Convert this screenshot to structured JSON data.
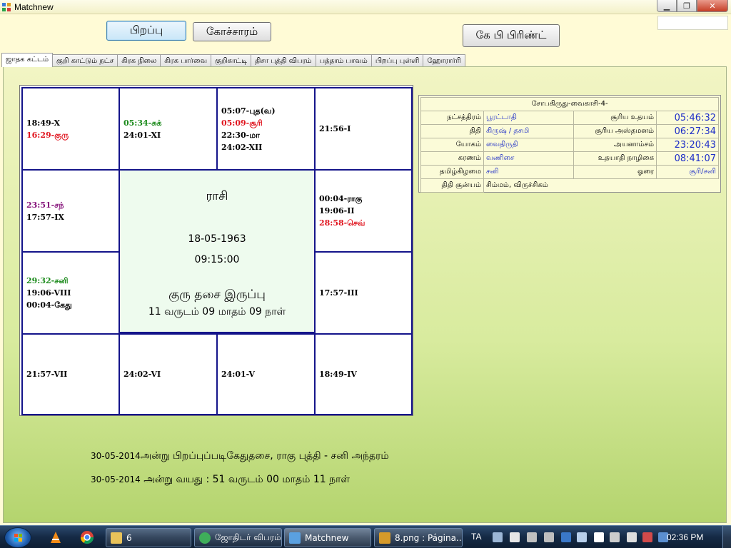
{
  "window": {
    "title": "Matchnew"
  },
  "toolbar": {
    "birth_button": "பிறப்பு",
    "transit_button": "கோச்சாரம்",
    "kp_print_button": "கே பி பிரிண்ட்"
  },
  "tabs": [
    "ஜாதக கட்டம்",
    "குறி காட்டும் நட்ச",
    "கிரக நிலை",
    "கிரக பார்வை",
    "குறிகாட்டி",
    "திசா புத்தி விபரம்",
    "பத்தாம் பாவம்",
    "பிறப்பு புள்ளி",
    "ஹோரார்ரி"
  ],
  "chart": {
    "cells": {
      "c1": [
        {
          "text": "18:49-X",
          "color": "black"
        },
        {
          "text": "16:29-குரு",
          "color": "red"
        }
      ],
      "c2": [
        {
          "text": "05:34-சுக்",
          "color": "green"
        },
        {
          "text": "24:01-XI",
          "color": "black"
        }
      ],
      "c3": [
        {
          "text": "05:07-புத(வ)",
          "color": "black"
        },
        {
          "text": "05:09-சூரி",
          "color": "red"
        },
        {
          "text": "22:30-மா",
          "color": "black"
        },
        {
          "text": "24:02-XII",
          "color": "black"
        }
      ],
      "c4": [
        {
          "text": "21:56-I",
          "color": "black"
        }
      ],
      "c5": [
        {
          "text": "23:51-சந்",
          "color": "purple"
        },
        {
          "text": "17:57-IX",
          "color": "black"
        }
      ],
      "c6": [
        {
          "text": "00:04-ராகு",
          "color": "black"
        },
        {
          "text": "19:06-II",
          "color": "black"
        },
        {
          "text": "28:58-செவ்",
          "color": "red"
        }
      ],
      "c7": [
        {
          "text": "29:32-சனி",
          "color": "green"
        },
        {
          "text": "19:06-VIII",
          "color": "black"
        },
        {
          "text": "00:04-கேது",
          "color": "black"
        }
      ],
      "c8": [
        {
          "text": "17:57-III",
          "color": "black"
        }
      ],
      "c9": [
        {
          "text": "21:57-VII",
          "color": "black"
        }
      ],
      "c10": [
        {
          "text": "24:02-VI",
          "color": "black"
        }
      ],
      "c11": [
        {
          "text": "24:01-V",
          "color": "black"
        }
      ],
      "c12": [
        {
          "text": "18:49-IV",
          "color": "black"
        }
      ]
    },
    "center": {
      "rasi": "ராசி",
      "date": "18-05-1963",
      "time": "09:15:00",
      "dasa": "குரு தசை இருப்பு",
      "dasa_remaining": "11 வருடம் 09 மாதம் 09 நாள்"
    }
  },
  "info": {
    "header": "சோபகிருது-வைகாசி-4-",
    "rows": [
      {
        "l1": "நட்சத்திரம்",
        "v1": "பூரட்டாதி",
        "l2": "சூரிய உதயம்",
        "v2": "05:46:32"
      },
      {
        "l1": "திதி",
        "v1": "கிருஷ் / தசமி",
        "l2": "சூரிய அஸ்தமனம்",
        "v2": "06:27:34"
      },
      {
        "l1": "யோகம்",
        "v1": "வைதிருதி",
        "l2": "அயனாம்சம்",
        "v2": "23:20:43"
      },
      {
        "l1": "கரணம்",
        "v1": "வணிசை",
        "l2": "உதயாதி நாழிகை",
        "v2": "08:41:07"
      },
      {
        "l1": "தமிழ்கிழமை",
        "v1": "சனி",
        "l2": "ஓரை",
        "v2": "சூரி/சனி"
      }
    ],
    "last": {
      "label": "திதி சூன்யம்",
      "value": "சிம்மம், விருச்சிகம்"
    }
  },
  "bottom": {
    "line1_date": "30-05-2014",
    "line1_text": "அன்று பிறப்புப்படிகேதுதசை, ராகு புத்தி - சனி அந்தரம்",
    "line2_date": "30-05-2014",
    "line2_text": " அன்று வயது  :  51 வருடம் 00 மாதம் 11 நாள்"
  },
  "taskbar": {
    "items": [
      {
        "label": "6"
      },
      {
        "label": "ஜோதிடர் விபரம்"
      },
      {
        "label": "Matchnew"
      },
      {
        "label": "8.png : Página..."
      }
    ],
    "lang": "TA",
    "clock": "02:36 PM"
  },
  "colors": {
    "grid_border": "#14148a",
    "red": "#e0141e",
    "green": "#1b8a1b",
    "purple": "#85127a",
    "value_blue": "#1e2ec8"
  }
}
